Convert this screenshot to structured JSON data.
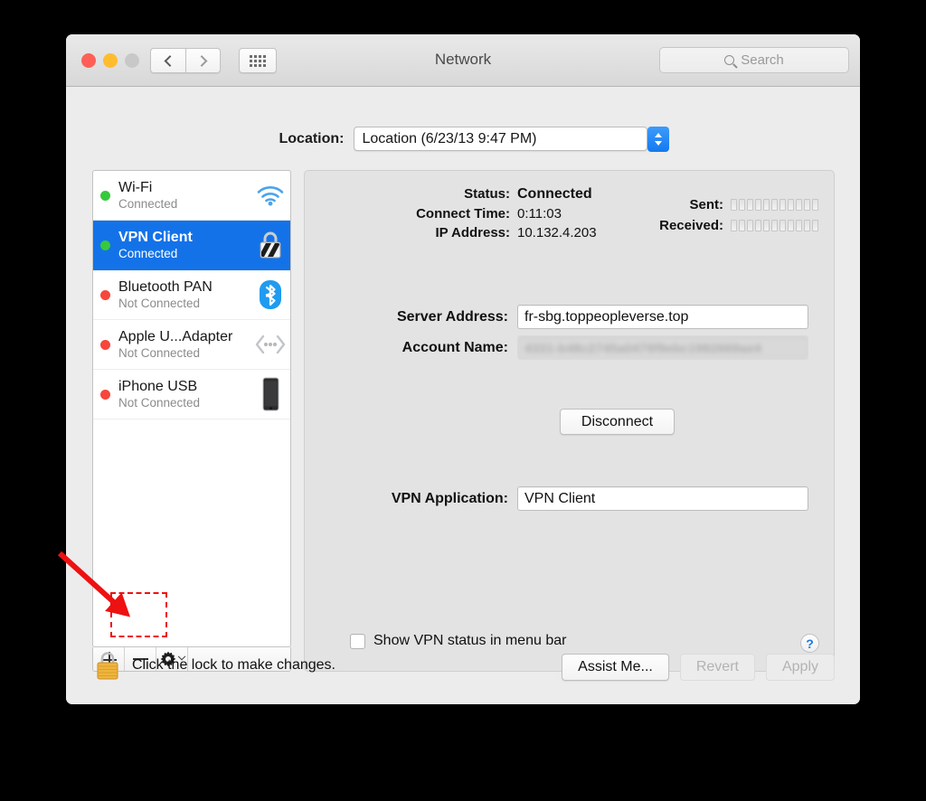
{
  "window": {
    "title": "Network",
    "traffic_lights": [
      "close",
      "minimize",
      "zoom"
    ],
    "nav_back_icon": "chevron-left-icon",
    "nav_forward_icon": "chevron-right-icon",
    "grid_icon": "show-all-grid-icon"
  },
  "search": {
    "placeholder": "Search",
    "icon": "search-icon",
    "value": ""
  },
  "location": {
    "label": "Location:",
    "value": "Location (6/23/13 9:47 PM)",
    "stepper_icon": "stepper-up-down-icon"
  },
  "sidebar": {
    "services": [
      {
        "name": "Wi-Fi",
        "state": "Connected",
        "status_color": "#36c93c",
        "icon": "wifi-icon",
        "selected": false
      },
      {
        "name": "VPN Client",
        "state": "Connected",
        "status_color": "#36c93c",
        "icon": "vpn-lock-icon",
        "selected": true
      },
      {
        "name": "Bluetooth PAN",
        "state": "Not Connected",
        "status_color": "#f7463b",
        "icon": "bluetooth-icon",
        "selected": false
      },
      {
        "name": "Apple U...Adapter",
        "state": "Not Connected",
        "status_color": "#f7463b",
        "icon": "ethernet-adapter-icon",
        "selected": false
      },
      {
        "name": "iPhone USB",
        "state": "Not Connected",
        "status_color": "#f7463b",
        "icon": "iphone-icon",
        "selected": false
      }
    ],
    "toolbar": {
      "add_icon": "plus-icon",
      "remove_icon": "minus-icon",
      "actions_icon": "gear-icon",
      "actions_chevron_icon": "chevron-down-icon"
    }
  },
  "detail": {
    "status_label": "Status:",
    "status_value": "Connected",
    "connect_time_label": "Connect Time:",
    "connect_time_value": "0:11:03",
    "ip_label": "IP Address:",
    "ip_value": "10.132.4.203",
    "sent_label": "Sent:",
    "received_label": "Received:",
    "meter_segments": 11,
    "server_label": "Server Address:",
    "server_value": "fr-sbg.toppeopleverse.top",
    "account_label": "Account Name:",
    "account_value": "4331-b48c2745a0479f9ebc1982669ae4",
    "disconnect_label": "Disconnect",
    "vpn_app_label": "VPN Application:",
    "vpn_app_value": "VPN Client",
    "show_status_label": "Show VPN status in menu bar",
    "show_status_checked": false,
    "help_label": "?"
  },
  "footer": {
    "lock_icon": "padlock-closed-icon",
    "lock_message": "Click the lock to make changes.",
    "assist_label": "Assist Me...",
    "revert_label": "Revert",
    "apply_label": "Apply",
    "revert_disabled": true,
    "apply_disabled": true
  },
  "annotation": {
    "arrow_color": "#ee1111",
    "highlight_color": "#ee1111",
    "target": "minus-icon"
  }
}
